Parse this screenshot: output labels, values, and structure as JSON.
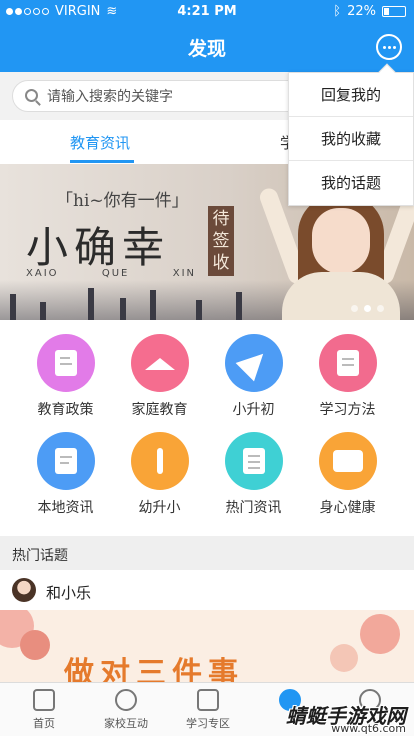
{
  "status": {
    "carrier": "VIRGIN",
    "time": "4:21 PM",
    "battery": "22%"
  },
  "nav": {
    "title": "发现"
  },
  "search": {
    "placeholder": "请输入搜索的关键字"
  },
  "tabs": [
    {
      "label": "教育资讯"
    },
    {
      "label": "学"
    }
  ],
  "banner": {
    "subtitle": "「hi~你有一件」",
    "title": "小确幸",
    "pinyin": [
      "XAIO",
      "QUE",
      "XIN"
    ],
    "stamp": "待签收"
  },
  "grid": [
    {
      "label": "教育政策",
      "icon": "policy-icon",
      "color": "#e27be8"
    },
    {
      "label": "家庭教育",
      "icon": "graduation-cap-icon",
      "color": "#f56d8f"
    },
    {
      "label": "小升初",
      "icon": "paper-plane-icon",
      "color": "#4d9cf5"
    },
    {
      "label": "学习方法",
      "icon": "book-icon",
      "color": "#f26b8e"
    },
    {
      "label": "本地资讯",
      "icon": "clipboard-icon",
      "color": "#4d9cf5"
    },
    {
      "label": "幼升小",
      "icon": "sprout-icon",
      "color": "#f9a437"
    },
    {
      "label": "热门资讯",
      "icon": "newspaper-icon",
      "color": "#3fd0d4"
    },
    {
      "label": "身心健康",
      "icon": "first-aid-kit-icon",
      "color": "#f9a437"
    }
  ],
  "hot": {
    "heading": "热门话题",
    "user": "和小乐",
    "headline": "做对三件事"
  },
  "menu": [
    {
      "label": "回复我的"
    },
    {
      "label": "我的收藏"
    },
    {
      "label": "我的话题"
    }
  ],
  "bottom_nav": [
    {
      "label": "首页",
      "icon": "home-icon"
    },
    {
      "label": "家校互动",
      "icon": "chat-icon"
    },
    {
      "label": "学习专区",
      "icon": "graduation-cap-icon"
    },
    {
      "label": "",
      "icon": "discover-icon"
    },
    {
      "label": "",
      "icon": "profile-icon"
    }
  ],
  "watermark": {
    "text": "蜻蜓手游戏网",
    "url": "www.qt6.com"
  },
  "colors": {
    "primary": "#2196f3"
  }
}
